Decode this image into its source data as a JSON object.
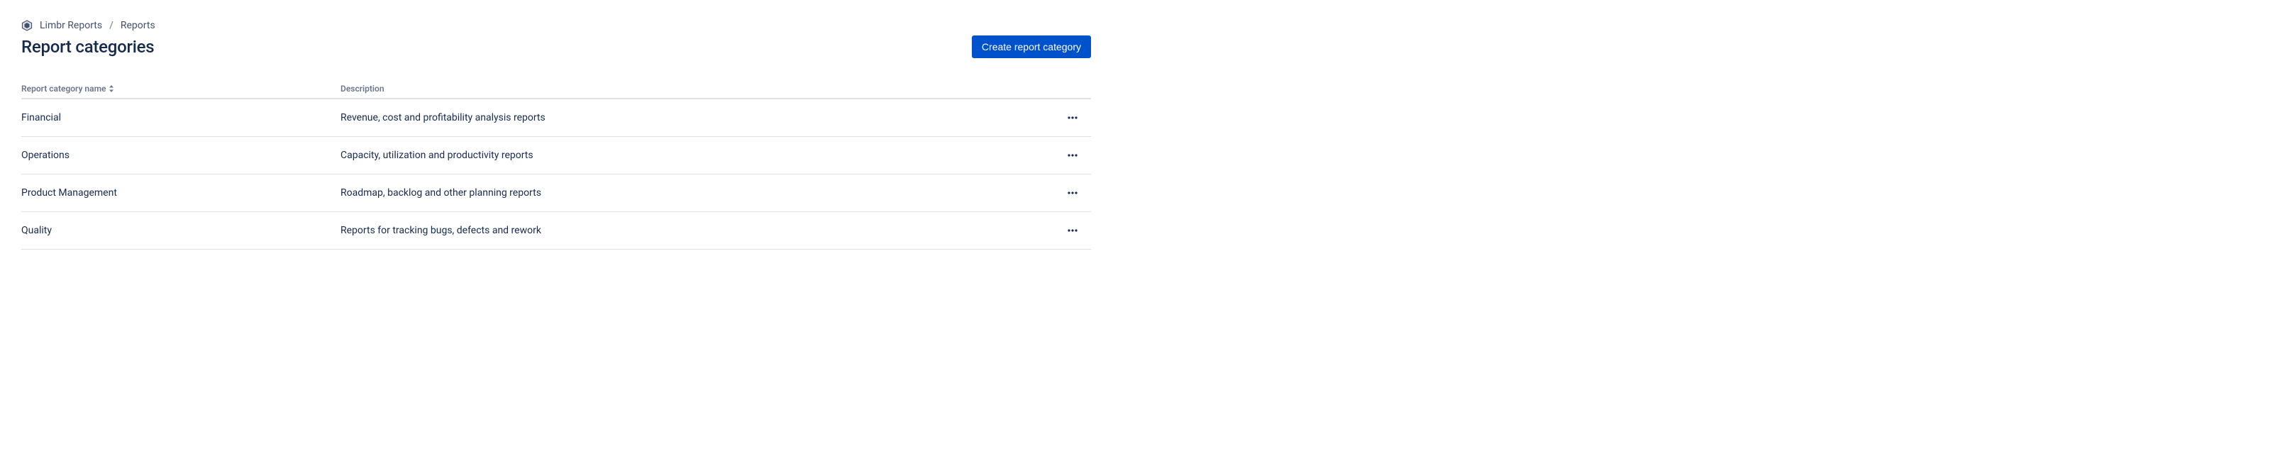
{
  "breadcrumb": {
    "root": "Limbr Reports",
    "current": "Reports"
  },
  "header": {
    "title": "Report categories",
    "create_button": "Create report category"
  },
  "table": {
    "columns": {
      "name": "Report category name",
      "description": "Description"
    },
    "rows": [
      {
        "name": "Financial",
        "description": "Revenue, cost and profitability analysis reports"
      },
      {
        "name": "Operations",
        "description": "Capacity, utilization and productivity reports"
      },
      {
        "name": "Product Management",
        "description": "Roadmap, backlog and other planning reports"
      },
      {
        "name": "Quality",
        "description": "Reports for tracking bugs, defects and rework"
      }
    ]
  }
}
